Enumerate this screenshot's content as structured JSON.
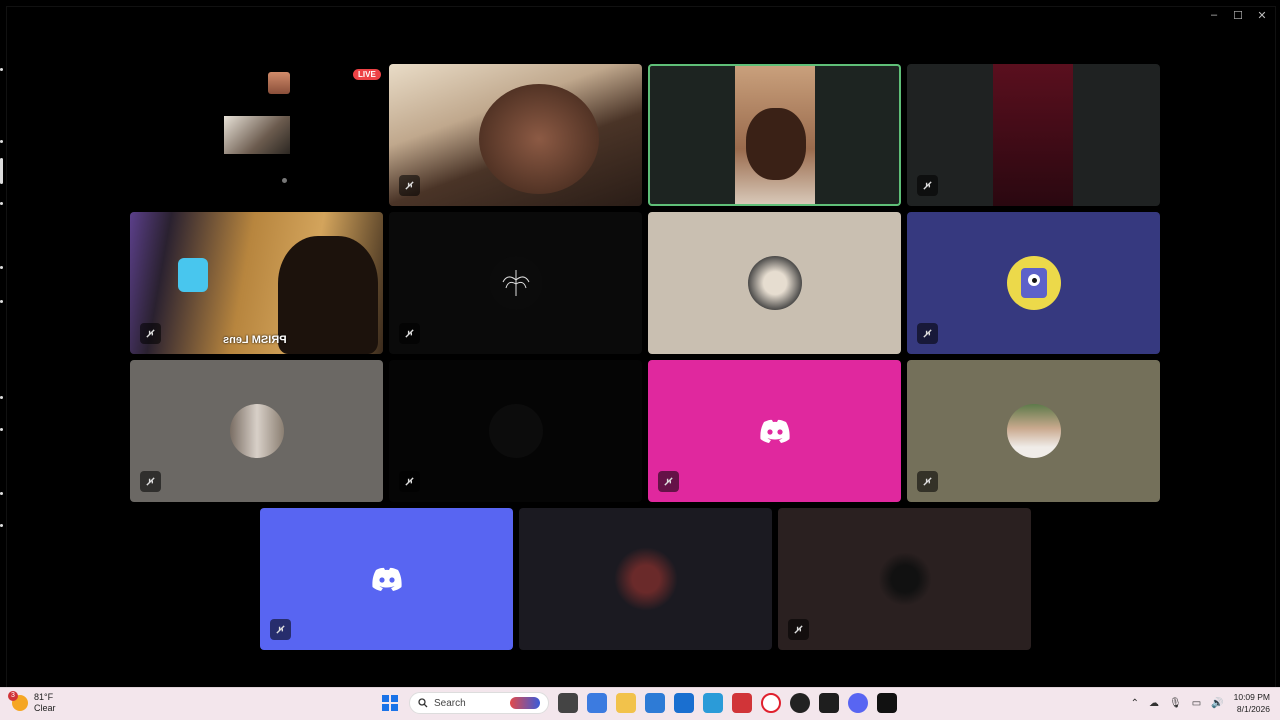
{
  "window": {
    "controls": [
      "–",
      "☐",
      "✕"
    ]
  },
  "stream": {
    "live_label": "LIVE"
  },
  "tiles": [
    {
      "id": "t1",
      "kind": "video",
      "muted": true,
      "bg": "#c9b39a"
    },
    {
      "id": "t2",
      "kind": "video",
      "muted": false,
      "speaking": true,
      "bg": "#1d2421"
    },
    {
      "id": "t3",
      "kind": "video",
      "muted": true,
      "bg": "#1f2222"
    },
    {
      "id": "t4",
      "kind": "video",
      "muted": true,
      "name": "PRISM Lens",
      "bg": "#3a2d1e"
    },
    {
      "id": "t5",
      "kind": "avatar",
      "muted": true,
      "bg": "#0a0a0a"
    },
    {
      "id": "t6",
      "kind": "avatar",
      "muted": false,
      "bg": "#c9bfb1"
    },
    {
      "id": "t7",
      "kind": "avatar",
      "muted": true,
      "bg": "#36397f"
    },
    {
      "id": "t8",
      "kind": "avatar",
      "muted": true,
      "bg": "#6b6864"
    },
    {
      "id": "t9",
      "kind": "avatar",
      "muted": true,
      "bg": "#050505"
    },
    {
      "id": "t10",
      "kind": "discord",
      "muted": true,
      "bg": "#e0289e"
    },
    {
      "id": "t11",
      "kind": "avatar",
      "muted": true,
      "bg": "#74705a"
    },
    {
      "id": "t12",
      "kind": "discord",
      "muted": true,
      "bg": "#5865f2"
    },
    {
      "id": "t13",
      "kind": "avatar",
      "muted": false,
      "bg": "#1b1a21"
    },
    {
      "id": "t14",
      "kind": "avatar",
      "muted": true,
      "bg": "#2a2020"
    }
  ],
  "taskbar": {
    "weather_temp": "81°F",
    "weather_desc": "Clear",
    "weather_badge": "3",
    "search_placeholder": "Search",
    "time": "10:09 PM",
    "date": "8/1/2026",
    "tray_icons": [
      "chevron-up-icon",
      "cloud-icon",
      "mic-icon",
      "monitor-icon",
      "speaker-icon"
    ]
  }
}
